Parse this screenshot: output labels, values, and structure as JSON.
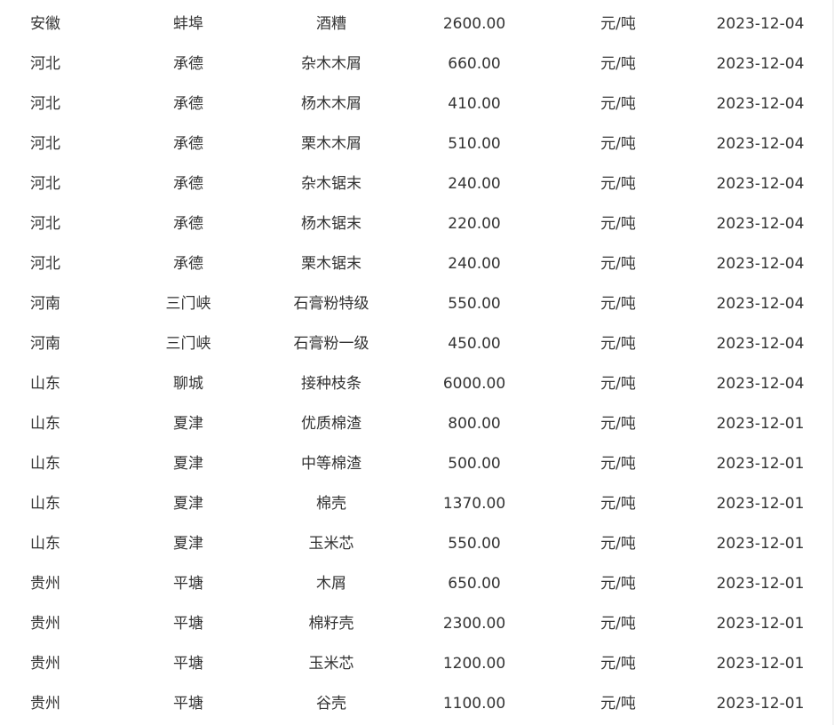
{
  "table": {
    "rows": [
      {
        "province": "安徽",
        "city": "蚌埠",
        "item": "酒糟",
        "price": "2600.00",
        "unit": "元/吨",
        "date": "2023-12-04"
      },
      {
        "province": "河北",
        "city": "承德",
        "item": "杂木木屑",
        "price": "660.00",
        "unit": "元/吨",
        "date": "2023-12-04"
      },
      {
        "province": "河北",
        "city": "承德",
        "item": "杨木木屑",
        "price": "410.00",
        "unit": "元/吨",
        "date": "2023-12-04"
      },
      {
        "province": "河北",
        "city": "承德",
        "item": "栗木木屑",
        "price": "510.00",
        "unit": "元/吨",
        "date": "2023-12-04"
      },
      {
        "province": "河北",
        "city": "承德",
        "item": "杂木锯末",
        "price": "240.00",
        "unit": "元/吨",
        "date": "2023-12-04"
      },
      {
        "province": "河北",
        "city": "承德",
        "item": "杨木锯末",
        "price": "220.00",
        "unit": "元/吨",
        "date": "2023-12-04"
      },
      {
        "province": "河北",
        "city": "承德",
        "item": "栗木锯末",
        "price": "240.00",
        "unit": "元/吨",
        "date": "2023-12-04"
      },
      {
        "province": "河南",
        "city": "三门峡",
        "item": "石膏粉特级",
        "price": "550.00",
        "unit": "元/吨",
        "date": "2023-12-04"
      },
      {
        "province": "河南",
        "city": "三门峡",
        "item": "石膏粉一级",
        "price": "450.00",
        "unit": "元/吨",
        "date": "2023-12-04"
      },
      {
        "province": "山东",
        "city": "聊城",
        "item": "接种枝条",
        "price": "6000.00",
        "unit": "元/吨",
        "date": "2023-12-04"
      },
      {
        "province": "山东",
        "city": "夏津",
        "item": "优质棉渣",
        "price": "800.00",
        "unit": "元/吨",
        "date": "2023-12-01"
      },
      {
        "province": "山东",
        "city": "夏津",
        "item": "中等棉渣",
        "price": "500.00",
        "unit": "元/吨",
        "date": "2023-12-01"
      },
      {
        "province": "山东",
        "city": "夏津",
        "item": "棉壳",
        "price": "1370.00",
        "unit": "元/吨",
        "date": "2023-12-01"
      },
      {
        "province": "山东",
        "city": "夏津",
        "item": "玉米芯",
        "price": "550.00",
        "unit": "元/吨",
        "date": "2023-12-01"
      },
      {
        "province": "贵州",
        "city": "平塘",
        "item": "木屑",
        "price": "650.00",
        "unit": "元/吨",
        "date": "2023-12-01"
      },
      {
        "province": "贵州",
        "city": "平塘",
        "item": "棉籽壳",
        "price": "2300.00",
        "unit": "元/吨",
        "date": "2023-12-01"
      },
      {
        "province": "贵州",
        "city": "平塘",
        "item": "玉米芯",
        "price": "1200.00",
        "unit": "元/吨",
        "date": "2023-12-01"
      },
      {
        "province": "贵州",
        "city": "平塘",
        "item": "谷壳",
        "price": "1100.00",
        "unit": "元/吨",
        "date": "2023-12-01"
      }
    ]
  }
}
